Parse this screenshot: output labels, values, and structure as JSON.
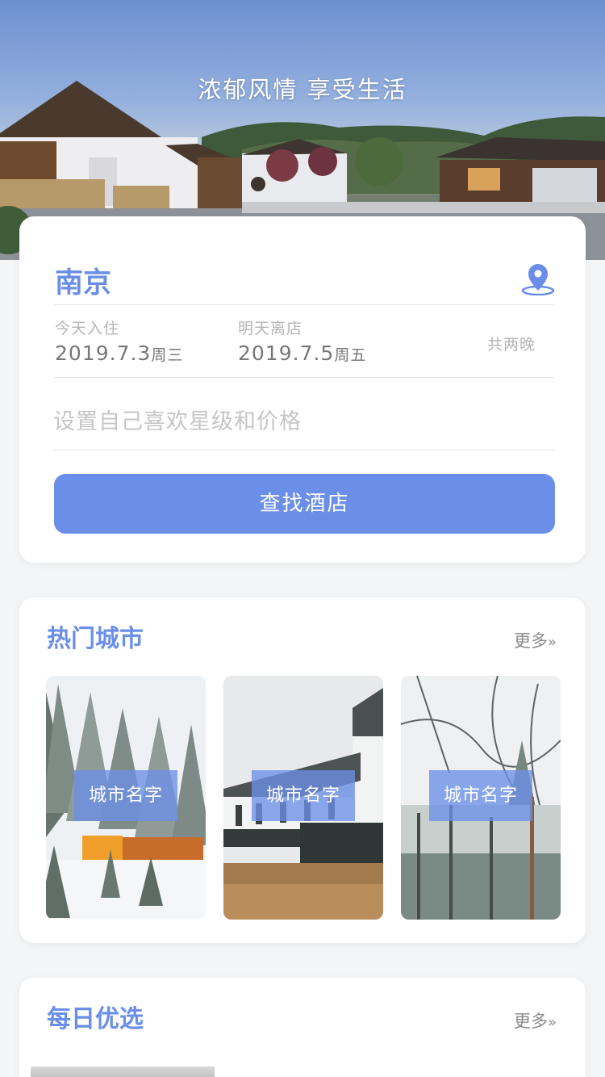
{
  "hero": {
    "title": "浓郁风情 享受生活"
  },
  "search": {
    "city": "南京",
    "checkin": {
      "label": "今天入住",
      "date": "2019.7.3",
      "weekday": "周三"
    },
    "checkout": {
      "label": "明天离店",
      "date": "2019.7.5",
      "weekday": "周五"
    },
    "nights": "共两晚",
    "preference_placeholder": "设置自己喜欢星级和价格",
    "button_label": "查找酒店"
  },
  "hot_cities": {
    "title": "热门城市",
    "more": "更多",
    "more_arrow": "»",
    "items": [
      {
        "label": "城市名字"
      },
      {
        "label": "城市名字"
      },
      {
        "label": "城市名字"
      }
    ]
  },
  "daily_picks": {
    "title": "每日优选",
    "more": "更多",
    "more_arrow": "»"
  },
  "colors": {
    "accent": "#6b8fe8",
    "page_bg": "#f4f5f7",
    "card_bg": "#ffffff"
  },
  "icons": {
    "location": "location-pin-icon"
  }
}
